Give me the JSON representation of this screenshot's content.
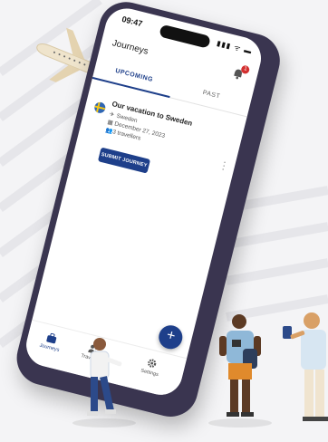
{
  "status": {
    "time": "09:47",
    "icons": "▮▮▮ ᯤ ▬"
  },
  "app": {
    "title": "Journeys",
    "notification_count": "1"
  },
  "tabs": [
    {
      "label": "UPCOMING",
      "active": true
    },
    {
      "label": "PAST",
      "active": false
    }
  ],
  "journey_card": {
    "title": "Our vacation to Sweden",
    "destination": "Sweden",
    "date": "December 27, 2023",
    "travellers": "3 travellers",
    "submit_label": "SUBMIT JOURNEY"
  },
  "bottom_nav": {
    "items": [
      {
        "label": "Journeys",
        "icon": "suitcase-icon"
      },
      {
        "label": "Travellers",
        "icon": "people-icon"
      },
      {
        "label": "Settings",
        "icon": "gear-icon"
      }
    ]
  },
  "fab": {
    "label": "+"
  },
  "colors": {
    "primary": "#1e3f8a",
    "badge": "#d32f2f",
    "phone_frame": "#3a3550"
  }
}
